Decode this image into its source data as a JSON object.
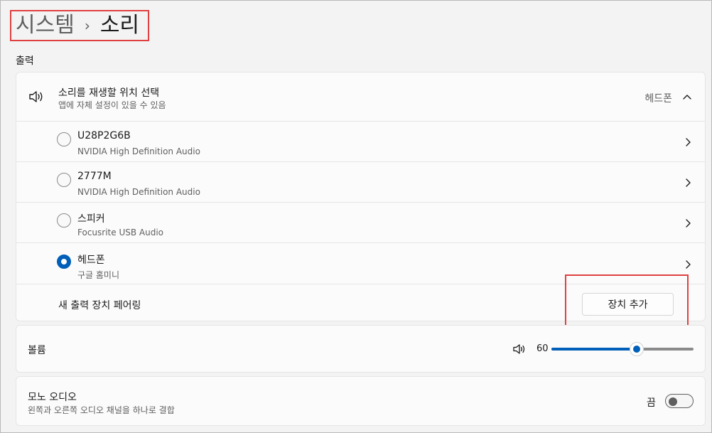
{
  "breadcrumb": {
    "parent": "시스템",
    "separator": "›",
    "current": "소리"
  },
  "output_section": {
    "label": "출력",
    "header": {
      "title": "소리를 재생할 위치 선택",
      "subtitle": "앱에 자체 설정이 있을 수 있음",
      "current_device": "헤드폰",
      "icon": "speaker-icon"
    },
    "devices": [
      {
        "name": "U28P2G6B",
        "subtitle": "NVIDIA High Definition Audio",
        "selected": false
      },
      {
        "name": "2777M",
        "subtitle": "NVIDIA High Definition Audio",
        "selected": false
      },
      {
        "name": "스피커",
        "subtitle": "Focusrite USB Audio",
        "selected": false
      },
      {
        "name": "헤드폰",
        "subtitle": "구글 홈미니",
        "selected": true
      }
    ],
    "pair": {
      "label": "새 출력 장치 페어링",
      "button_label": "장치 추가"
    }
  },
  "volume": {
    "label": "볼륨",
    "value": "60",
    "level_percent": 60,
    "icon": "volume-icon"
  },
  "mono_audio": {
    "title": "모노 오디오",
    "subtitle": "왼쪽과 오른쪽 오디오 채널을 하나로 결합",
    "state_label": "끔",
    "on": false
  },
  "colors": {
    "accent": "#005fb8",
    "annotation": "#e04040"
  }
}
